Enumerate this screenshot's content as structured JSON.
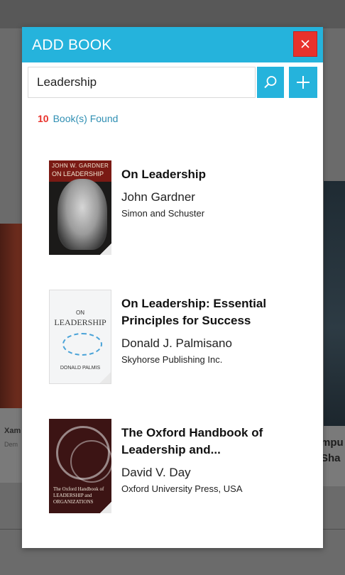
{
  "background": {
    "left_card": {
      "line1": "Xam",
      "line2": "Dem"
    },
    "right_card": {
      "line1": "mpu",
      "line2": "Sha"
    }
  },
  "modal": {
    "title": "ADD BOOK",
    "close_icon": "close-icon",
    "search": {
      "value": "Leadership",
      "placeholder": ""
    },
    "search_icon": "search-icon",
    "add_icon": "plus-icon",
    "results": {
      "count": "10",
      "label": "Book(s) Found"
    },
    "books": [
      {
        "title": "On Leadership",
        "author": "John Gardner",
        "publisher": "Simon and Schuster",
        "cover": {
          "line1": "JOHN W. GARDNER",
          "line2": "ON LEADERSHIP"
        }
      },
      {
        "title": "On Leadership: Essential Principles for Success",
        "author": "Donald J. Palmisano",
        "publisher": "Skyhorse Publishing Inc.",
        "cover": {
          "line1": "ON",
          "line2": "LEADERSHIP",
          "line3": "DONALD PALMIS"
        }
      },
      {
        "title": "The Oxford Handbook of Leadership and...",
        "author": "David V. Day",
        "publisher": "Oxford University Press, USA",
        "cover": {
          "line1": "The Oxford Handbook of",
          "line2": "LEADERSHIP and",
          "line3": "ORGANIZATIONS"
        }
      }
    ]
  },
  "colors": {
    "accent": "#25b3dc",
    "danger": "#e8322c",
    "link": "#2f8fb3"
  }
}
